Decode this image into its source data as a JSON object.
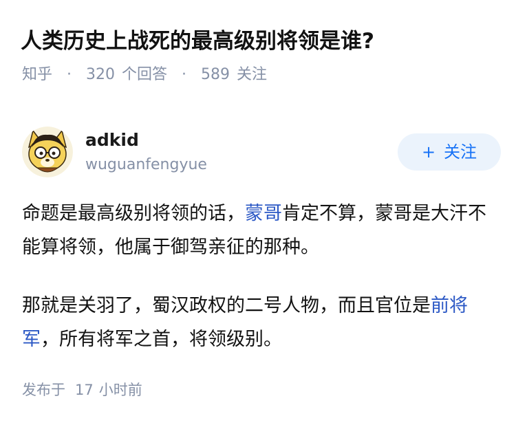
{
  "question": {
    "title": "人类历史上战死的最高级别将领是谁?",
    "source": "知乎",
    "separator": "·",
    "answer_count": "320",
    "answer_label": "个回答",
    "follower_count": "589",
    "follower_label": "关注"
  },
  "author": {
    "name": "adkid",
    "bio": "wuguanfengyue",
    "avatar_icon": "cartoon-avatar-icon",
    "follow_button": {
      "plus": "+",
      "label": "关注"
    }
  },
  "answer": {
    "p1": {
      "text_a": "命题是最高级别将领的话，",
      "link": "蒙哥",
      "text_b": "肯定不算，蒙哥是大汗不能算将领，他属于御驾亲征的那种。"
    },
    "p2": {
      "text_a": "那就是关羽了，蜀汉政权的二号人物，而且官位是",
      "link": "前将军",
      "text_b": "，所有将军之首，将领级别。"
    },
    "link_color": "#2b58c5"
  },
  "footer": {
    "publish_prefix": "发布于",
    "publish_number": "17",
    "publish_unit": "小时前"
  },
  "colors": {
    "meta_gray": "#8590a6",
    "follow_blue": "#1772f6",
    "follow_bg": "#ebf3fc"
  }
}
